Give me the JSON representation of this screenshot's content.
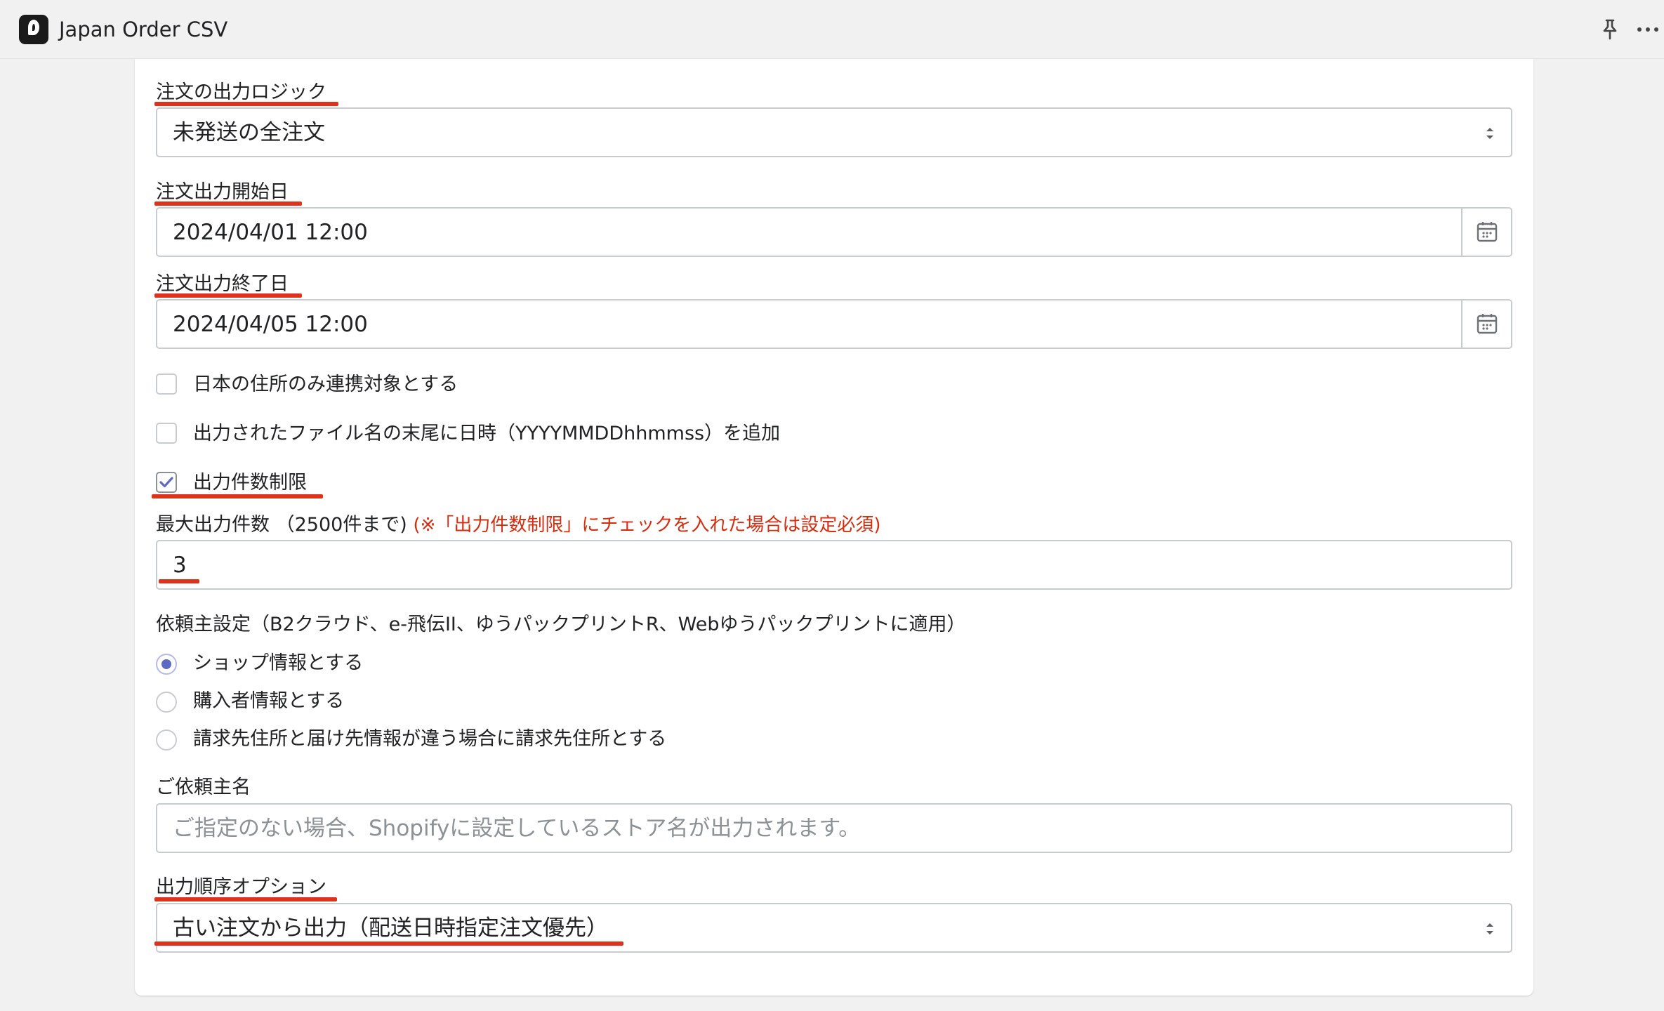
{
  "header": {
    "app_title": "Japan Order CSV",
    "icons": [
      "app-logo-icon",
      "pin-icon",
      "more-horizontal-icon"
    ]
  },
  "form": {
    "logic": {
      "label": "注文の出力ロジック",
      "value": "未発送の全注文"
    },
    "start_date": {
      "label": "注文出力開始日",
      "value": "2024/04/01 12:00"
    },
    "end_date": {
      "label": "注文出力終了日",
      "value": "2024/04/05 12:00"
    },
    "checkboxes": [
      {
        "label": "日本の住所のみ連携対象とする",
        "checked": false
      },
      {
        "label": "出力されたファイル名の末尾に日時（YYYYMMDDhhmmss）を追加",
        "checked": false
      },
      {
        "label": "出力件数制限",
        "checked": true
      }
    ],
    "max_count": {
      "label": "最大出力件数 （2500件まで)",
      "note": "(※「出力件数制限」にチェックを入れた場合は設定必須)",
      "value": "3"
    },
    "requester_setting": {
      "label": "依頼主設定（B2クラウド、e-飛伝II、ゆうパックプリントR、Webゆうパックプリントに適用）",
      "options": [
        {
          "label": "ショップ情報とする",
          "selected": true
        },
        {
          "label": "購入者情報とする",
          "selected": false
        },
        {
          "label": "請求先住所と届け先情報が違う場合に請求先住所とする",
          "selected": false
        }
      ]
    },
    "requester_name": {
      "label": "ご依頼主名",
      "placeholder": "ご指定のない場合、Shopifyに設定しているストア名が出力されます。"
    },
    "order_option": {
      "label": "出力順序オプション",
      "value": "古い注文から出力（配送日時指定注文優先）"
    }
  },
  "colors": {
    "highlight_underline": "#e0321a",
    "note_red": "#d72c0d",
    "accent": "#5c6ac4"
  }
}
